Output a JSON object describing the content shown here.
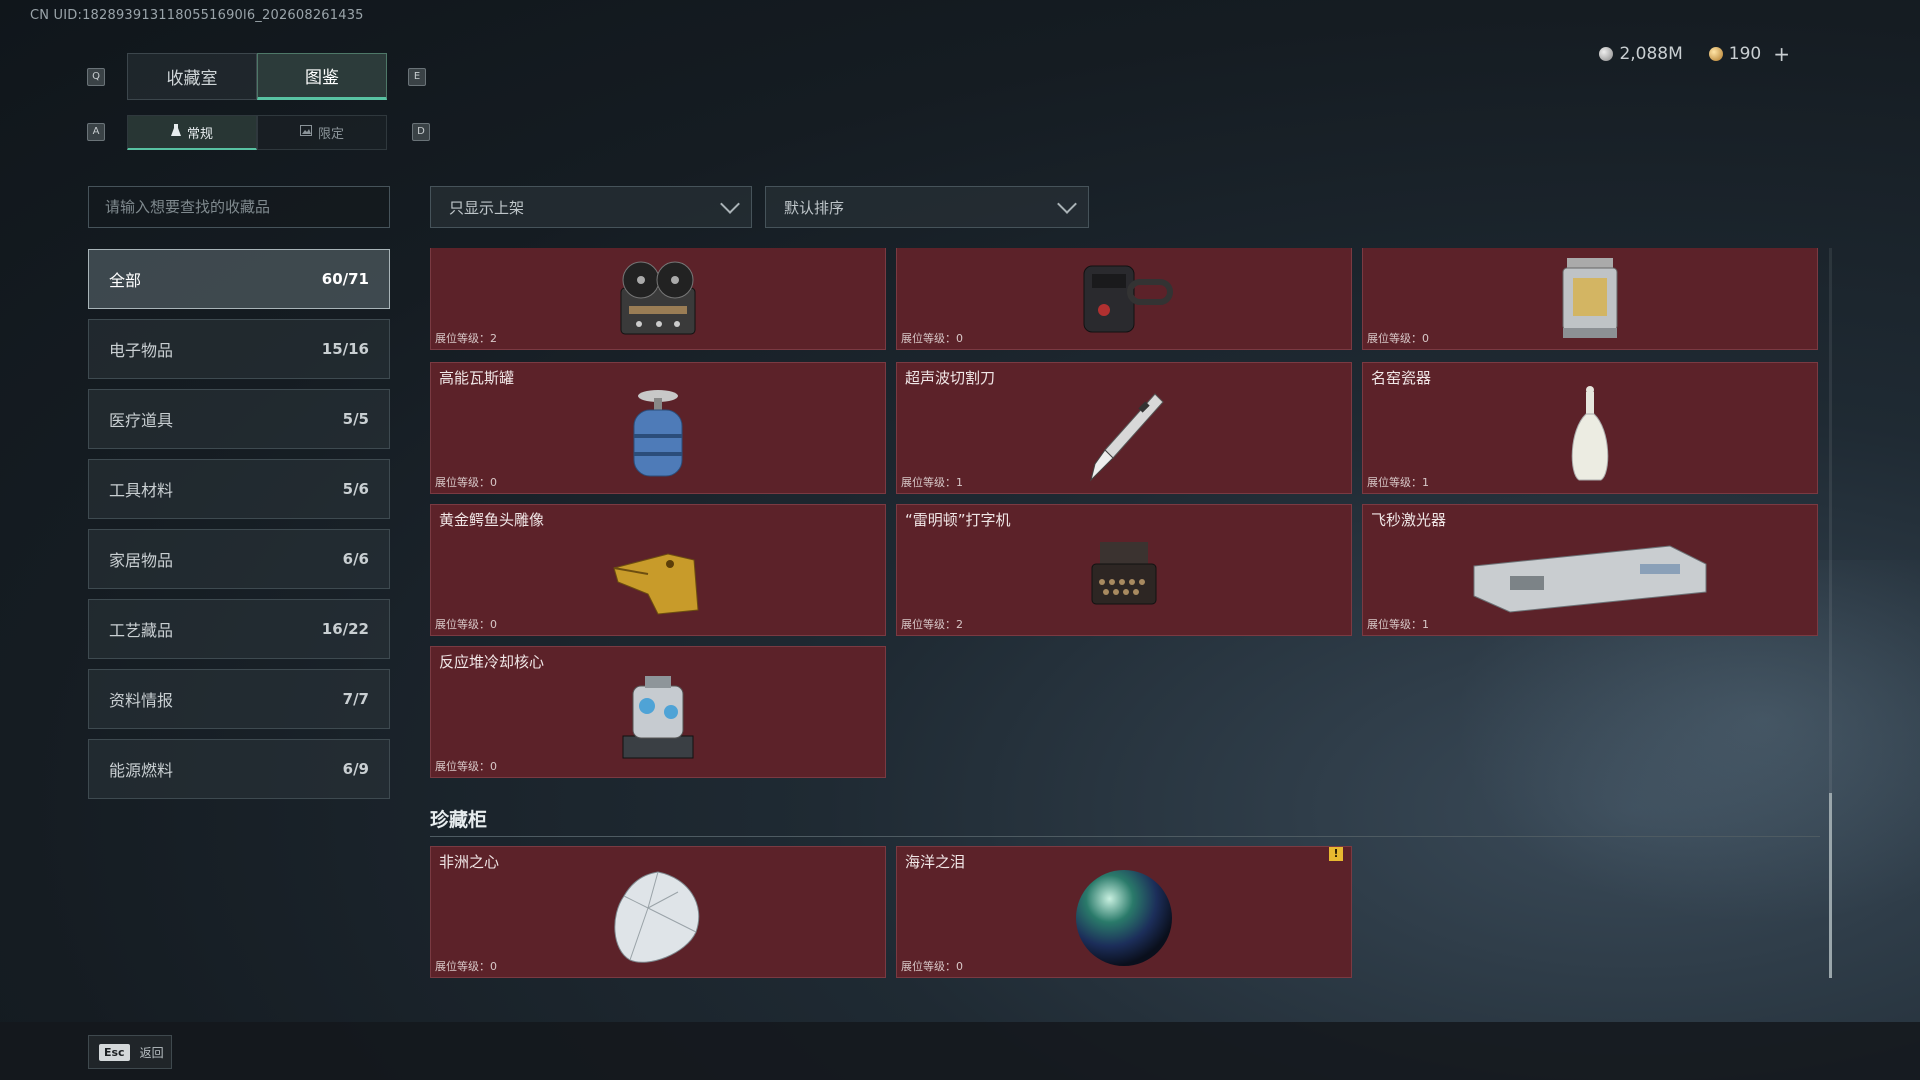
{
  "uid_text": "CN UID:1828939131180551690l6_202608261435",
  "currency": {
    "silver": "2,088M",
    "gold": "190",
    "plus": "+",
    "silver_icon": "silver-coin-icon",
    "gold_icon": "gold-coin-icon"
  },
  "keys": {
    "q": "Q",
    "e": "E",
    "a": "A",
    "d": "D"
  },
  "tabs": [
    {
      "label": "收藏室"
    },
    {
      "label": "图鉴"
    }
  ],
  "subtabs": [
    {
      "label": "常规",
      "icon": "flask-icon"
    },
    {
      "label": "限定",
      "icon": "image-icon"
    }
  ],
  "search": {
    "placeholder": "请输入想要查找的收藏品",
    "value": ""
  },
  "filters": {
    "shelf": "只显示上架",
    "sort": "默认排序"
  },
  "categories": [
    {
      "label": "全部",
      "count": "60/71"
    },
    {
      "label": "电子物品",
      "count": "15/16"
    },
    {
      "label": "医疗道具",
      "count": "5/5"
    },
    {
      "label": "工具材料",
      "count": "5/6"
    },
    {
      "label": "家居物品",
      "count": "6/6"
    },
    {
      "label": "工艺藏品",
      "count": "16/22"
    },
    {
      "label": "资料情报",
      "count": "7/7"
    },
    {
      "label": "能源燃料",
      "count": "6/9"
    }
  ],
  "items": [
    {
      "name": "",
      "level": "展位等级：2",
      "icon": "reel-recorder-icon"
    },
    {
      "name": "",
      "level": "展位等级：0",
      "icon": "device-icon"
    },
    {
      "name": "",
      "level": "展位等级：0",
      "icon": "lantern-icon"
    },
    {
      "name": "高能瓦斯罐",
      "level": "展位等级：0",
      "icon": "gas-canister-icon"
    },
    {
      "name": "超声波切割刀",
      "level": "展位等级：1",
      "icon": "ultrasonic-knife-icon"
    },
    {
      "name": "名窑瓷器",
      "level": "展位等级：1",
      "icon": "porcelain-vase-icon"
    },
    {
      "name": "黄金鳄鱼头雕像",
      "level": "展位等级：0",
      "icon": "gold-crocodile-icon"
    },
    {
      "name": "“雷明顿”打字机",
      "level": "展位等级：2",
      "icon": "typewriter-icon"
    },
    {
      "name": "飞秒激光器",
      "level": "展位等级：1",
      "icon": "laser-device-icon"
    },
    {
      "name": "反应堆冷却核心",
      "level": "展位等级：0",
      "icon": "reactor-core-icon"
    }
  ],
  "treasure_section": {
    "title": "珍藏柜"
  },
  "treasure_items": [
    {
      "name": "非洲之心",
      "level": "展位等级：0",
      "icon": "diamond-icon"
    },
    {
      "name": "海洋之泪",
      "level": "展位等级：0",
      "icon": "pearl-icon",
      "warn": "!"
    }
  ],
  "bottom": {
    "esc_key": "Esc",
    "esc_label": "返回"
  }
}
